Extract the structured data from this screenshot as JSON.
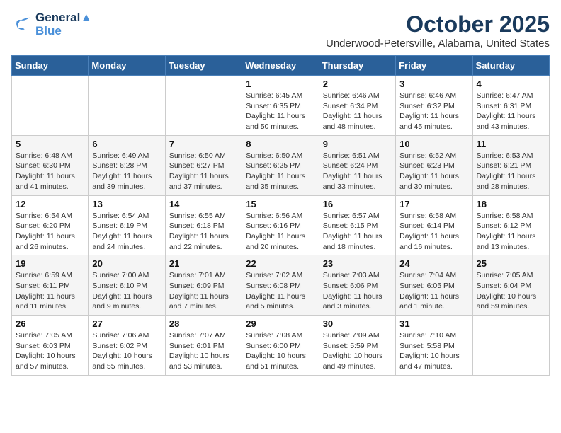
{
  "header": {
    "logo_line1": "General",
    "logo_line2": "Blue",
    "month": "October 2025",
    "location": "Underwood-Petersville, Alabama, United States"
  },
  "weekdays": [
    "Sunday",
    "Monday",
    "Tuesday",
    "Wednesday",
    "Thursday",
    "Friday",
    "Saturday"
  ],
  "weeks": [
    [
      {
        "day": "",
        "info": ""
      },
      {
        "day": "",
        "info": ""
      },
      {
        "day": "",
        "info": ""
      },
      {
        "day": "1",
        "info": "Sunrise: 6:45 AM\nSunset: 6:35 PM\nDaylight: 11 hours\nand 50 minutes."
      },
      {
        "day": "2",
        "info": "Sunrise: 6:46 AM\nSunset: 6:34 PM\nDaylight: 11 hours\nand 48 minutes."
      },
      {
        "day": "3",
        "info": "Sunrise: 6:46 AM\nSunset: 6:32 PM\nDaylight: 11 hours\nand 45 minutes."
      },
      {
        "day": "4",
        "info": "Sunrise: 6:47 AM\nSunset: 6:31 PM\nDaylight: 11 hours\nand 43 minutes."
      }
    ],
    [
      {
        "day": "5",
        "info": "Sunrise: 6:48 AM\nSunset: 6:30 PM\nDaylight: 11 hours\nand 41 minutes."
      },
      {
        "day": "6",
        "info": "Sunrise: 6:49 AM\nSunset: 6:28 PM\nDaylight: 11 hours\nand 39 minutes."
      },
      {
        "day": "7",
        "info": "Sunrise: 6:50 AM\nSunset: 6:27 PM\nDaylight: 11 hours\nand 37 minutes."
      },
      {
        "day": "8",
        "info": "Sunrise: 6:50 AM\nSunset: 6:25 PM\nDaylight: 11 hours\nand 35 minutes."
      },
      {
        "day": "9",
        "info": "Sunrise: 6:51 AM\nSunset: 6:24 PM\nDaylight: 11 hours\nand 33 minutes."
      },
      {
        "day": "10",
        "info": "Sunrise: 6:52 AM\nSunset: 6:23 PM\nDaylight: 11 hours\nand 30 minutes."
      },
      {
        "day": "11",
        "info": "Sunrise: 6:53 AM\nSunset: 6:21 PM\nDaylight: 11 hours\nand 28 minutes."
      }
    ],
    [
      {
        "day": "12",
        "info": "Sunrise: 6:54 AM\nSunset: 6:20 PM\nDaylight: 11 hours\nand 26 minutes."
      },
      {
        "day": "13",
        "info": "Sunrise: 6:54 AM\nSunset: 6:19 PM\nDaylight: 11 hours\nand 24 minutes."
      },
      {
        "day": "14",
        "info": "Sunrise: 6:55 AM\nSunset: 6:18 PM\nDaylight: 11 hours\nand 22 minutes."
      },
      {
        "day": "15",
        "info": "Sunrise: 6:56 AM\nSunset: 6:16 PM\nDaylight: 11 hours\nand 20 minutes."
      },
      {
        "day": "16",
        "info": "Sunrise: 6:57 AM\nSunset: 6:15 PM\nDaylight: 11 hours\nand 18 minutes."
      },
      {
        "day": "17",
        "info": "Sunrise: 6:58 AM\nSunset: 6:14 PM\nDaylight: 11 hours\nand 16 minutes."
      },
      {
        "day": "18",
        "info": "Sunrise: 6:58 AM\nSunset: 6:12 PM\nDaylight: 11 hours\nand 13 minutes."
      }
    ],
    [
      {
        "day": "19",
        "info": "Sunrise: 6:59 AM\nSunset: 6:11 PM\nDaylight: 11 hours\nand 11 minutes."
      },
      {
        "day": "20",
        "info": "Sunrise: 7:00 AM\nSunset: 6:10 PM\nDaylight: 11 hours\nand 9 minutes."
      },
      {
        "day": "21",
        "info": "Sunrise: 7:01 AM\nSunset: 6:09 PM\nDaylight: 11 hours\nand 7 minutes."
      },
      {
        "day": "22",
        "info": "Sunrise: 7:02 AM\nSunset: 6:08 PM\nDaylight: 11 hours\nand 5 minutes."
      },
      {
        "day": "23",
        "info": "Sunrise: 7:03 AM\nSunset: 6:06 PM\nDaylight: 11 hours\nand 3 minutes."
      },
      {
        "day": "24",
        "info": "Sunrise: 7:04 AM\nSunset: 6:05 PM\nDaylight: 11 hours\nand 1 minute."
      },
      {
        "day": "25",
        "info": "Sunrise: 7:05 AM\nSunset: 6:04 PM\nDaylight: 10 hours\nand 59 minutes."
      }
    ],
    [
      {
        "day": "26",
        "info": "Sunrise: 7:05 AM\nSunset: 6:03 PM\nDaylight: 10 hours\nand 57 minutes."
      },
      {
        "day": "27",
        "info": "Sunrise: 7:06 AM\nSunset: 6:02 PM\nDaylight: 10 hours\nand 55 minutes."
      },
      {
        "day": "28",
        "info": "Sunrise: 7:07 AM\nSunset: 6:01 PM\nDaylight: 10 hours\nand 53 minutes."
      },
      {
        "day": "29",
        "info": "Sunrise: 7:08 AM\nSunset: 6:00 PM\nDaylight: 10 hours\nand 51 minutes."
      },
      {
        "day": "30",
        "info": "Sunrise: 7:09 AM\nSunset: 5:59 PM\nDaylight: 10 hours\nand 49 minutes."
      },
      {
        "day": "31",
        "info": "Sunrise: 7:10 AM\nSunset: 5:58 PM\nDaylight: 10 hours\nand 47 minutes."
      },
      {
        "day": "",
        "info": ""
      }
    ]
  ]
}
